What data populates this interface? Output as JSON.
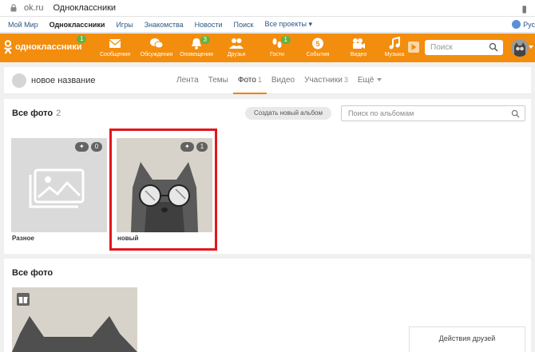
{
  "browser": {
    "url": "ok.ru",
    "tab_title": "Одноклассники"
  },
  "portal": {
    "links": [
      "Мой Мир",
      "Одноклассники",
      "Игры",
      "Знакомства",
      "Новости",
      "Поиск",
      "Все проекты"
    ],
    "lang": "Рус"
  },
  "toolbar": {
    "logo_text": "одноклассники",
    "logo_badge": "1",
    "items": [
      {
        "label": "Сообщения",
        "icon": "envelope-icon",
        "badge": ""
      },
      {
        "label": "Обсуждения",
        "icon": "chat-icon",
        "badge": ""
      },
      {
        "label": "Оповещения",
        "icon": "bell-icon",
        "badge": "3"
      },
      {
        "label": "Друзья",
        "icon": "friends-icon",
        "badge": ""
      },
      {
        "label": "Гости",
        "icon": "footprints-icon",
        "badge": "1"
      },
      {
        "label": "События",
        "icon": "events-icon",
        "badge": ""
      },
      {
        "label": "Видео",
        "icon": "video-icon",
        "badge": ""
      },
      {
        "label": "Музыка",
        "icon": "music-icon",
        "badge": ""
      }
    ],
    "search_placeholder": "Поиск"
  },
  "group": {
    "name": "новое название",
    "tabs": [
      {
        "label": "Лента",
        "count": ""
      },
      {
        "label": "Темы",
        "count": ""
      },
      {
        "label": "Фото",
        "count": "1"
      },
      {
        "label": "Видео",
        "count": ""
      },
      {
        "label": "Участники",
        "count": "3"
      },
      {
        "label": "Ещё",
        "count": ""
      }
    ]
  },
  "albums": {
    "title": "Все фото",
    "count": "2",
    "create_button": "Создать новый альбом",
    "search_placeholder": "Поиск по альбомам",
    "items": [
      {
        "name": "Разное",
        "count": "0"
      },
      {
        "name": "новый",
        "count": "1"
      }
    ]
  },
  "all_photos": {
    "title": "Все фото"
  },
  "friends_panel": {
    "label": "Действия друзей"
  },
  "colors": {
    "toolbar": "#f38d0d",
    "badge": "#60b442",
    "highlight": "#e1161f"
  }
}
